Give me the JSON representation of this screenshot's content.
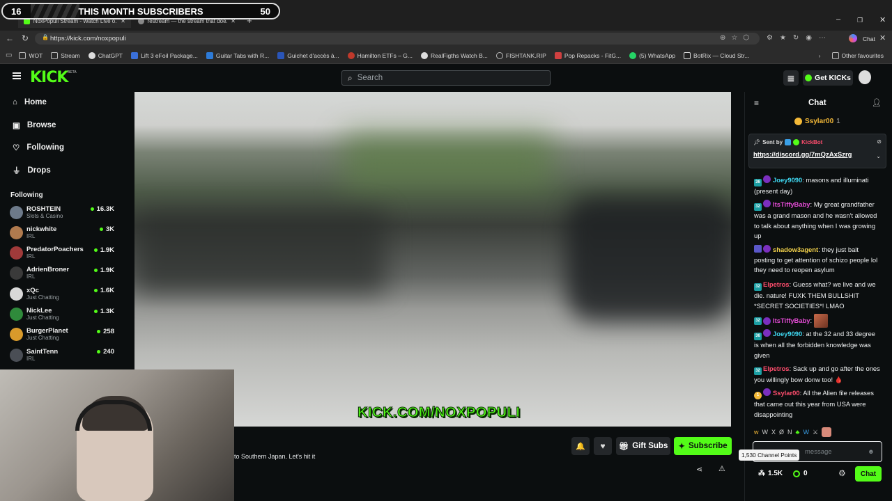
{
  "overlay": {
    "left_number": "16",
    "title": "THIS MONTH SUBSCRIBERS",
    "right_number": "50"
  },
  "browser": {
    "tabs": [
      {
        "label": "NoxPopuli Stream - Watch Live o..."
      },
      {
        "label": "restream — the stream that doe..."
      }
    ],
    "url": "https://kick.com/noxpopuli",
    "copilot_label": "Chat",
    "bookmarks": [
      "WOT",
      "Stream",
      "ChatGPT",
      "Lift 3 eFoil Package...",
      "Guitar Tabs with R...",
      "Guichet d'accès à...",
      "Hamilton ETFs – G...",
      "RealFigths Watch B...",
      "FISHTANK.RIP",
      "Pop Repacks - FitG...",
      "(5) WhatsApp",
      "BotRix — Cloud Str...",
      "Other favourites"
    ]
  },
  "kick": {
    "logo": "KICK",
    "logo_badge": "BETA",
    "search_placeholder": "Search",
    "get_kicks": "Get KICKs"
  },
  "sidebar": {
    "nav": [
      {
        "label": "Home"
      },
      {
        "label": "Browse"
      },
      {
        "label": "Following"
      },
      {
        "label": "Drops"
      }
    ],
    "following_heading": "Following",
    "following": [
      {
        "name": "ROSHTEIN",
        "category": "Slots & Casino",
        "viewers": "16.3K",
        "color": "#6d7a8a"
      },
      {
        "name": "nickwhite",
        "category": "IRL",
        "viewers": "3K",
        "color": "#b07a4e"
      },
      {
        "name": "PredatorPoachers",
        "category": "IRL",
        "viewers": "1.9K",
        "color": "#a03a3a"
      },
      {
        "name": "AdrienBroner",
        "category": "IRL",
        "viewers": "1.9K",
        "color": "#3a3a3a"
      },
      {
        "name": "xQc",
        "category": "Just Chatting",
        "viewers": "1.6K",
        "color": "#d8d8d8"
      },
      {
        "name": "NickLee",
        "category": "Just Chatting",
        "viewers": "1.3K",
        "color": "#2f8a3b"
      },
      {
        "name": "BurgerPlanet",
        "category": "Just Chatting",
        "viewers": "258",
        "color": "#d99a2b"
      },
      {
        "name": "SaintTenn",
        "category": "IRL",
        "viewers": "240",
        "color": "#4a4e55"
      }
    ]
  },
  "video": {
    "watermark": "KICK.COM/NOXPOPULI"
  },
  "stream_info": {
    "title_tail": "to Southern Japan. Let's hit it",
    "gift_subs": "Gift Subs",
    "subscribe": "Subscribe"
  },
  "chat": {
    "title": "Chat",
    "top_gifter": {
      "name": "Ssylar00",
      "count": "1"
    },
    "pinned": {
      "sent_by": "Sent by",
      "sender": "KickBot",
      "link": "https://discord.gg/7mQzAxSzrg"
    },
    "messages": [
      {
        "badge": "36",
        "user": "Joey9090",
        "color": "#3fd7f0",
        "text": "masons and illuminati (present day)"
      },
      {
        "badge": "32",
        "user": "ItsTiffyBaby",
        "color": "#e24bd3",
        "text": "My great grandfather was a grand mason and he wasn't allowed to talk about anything when I was growing up"
      },
      {
        "badge": "",
        "user": "shadow3agent",
        "color": "#f2d14b",
        "text": "they just bait posting to get attention of schizo people lol they need to reopen asylum"
      },
      {
        "badge": "32",
        "user": "Elpetros",
        "color": "#ff4d6d",
        "text": "Guess what? we live and we die. nature! FUXK THEM BULLSHIT *SECRET SOCIETIES*! LMAO"
      },
      {
        "badge": "32",
        "user": "ItsTiffyBaby",
        "color": "#e24bd3",
        "text": ""
      },
      {
        "badge": "36",
        "user": "Joey9090",
        "color": "#3fd7f0",
        "text": "at the 32 and 33 degree is when all the forbidden knowledge was given"
      },
      {
        "badge": "32",
        "user": "Elpetros",
        "color": "#ff4d6d",
        "text": "Sack up and go after the ones you willingly bow donw too! 🩸"
      },
      {
        "badge": "1",
        "user": "Ssylar00",
        "color": "#ff4d6d",
        "text": "All the Alien file releases that came out this year from USA were disappointing"
      }
    ],
    "input_placeholder": "message",
    "tooltip": "1,530 Channel Points",
    "points": "1.5K",
    "kicks": "0",
    "send_label": "Chat"
  },
  "colors": {
    "accent": "#53fc18",
    "bg": "#0b0e0f"
  }
}
